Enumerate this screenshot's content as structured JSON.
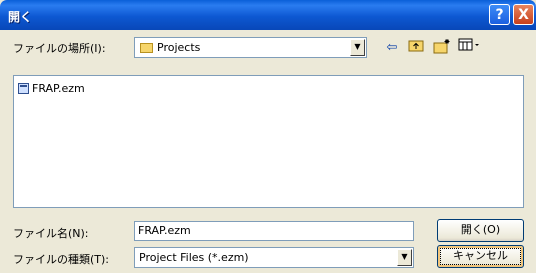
{
  "window": {
    "title": "開く",
    "help_glyph": "?",
    "close_glyph": "X"
  },
  "location": {
    "label": "ファイルの場所(I):",
    "value": "Projects"
  },
  "toolbar": {
    "icons": [
      "back-arrow-icon",
      "up-folder-icon",
      "new-folder-icon",
      "view-menu-icon"
    ]
  },
  "files": [
    {
      "name": "FRAP.ezm"
    }
  ],
  "filename": {
    "label": "ファイル名(N):",
    "value": "FRAP.ezm"
  },
  "filetype": {
    "label": "ファイルの種類(T):",
    "value": "Project Files (*.ezm)"
  },
  "buttons": {
    "open": "開く(O)",
    "cancel": "キャンセル"
  },
  "colors": {
    "titlebar": "#0a5fd8",
    "dialog_bg": "#ece9d8"
  }
}
